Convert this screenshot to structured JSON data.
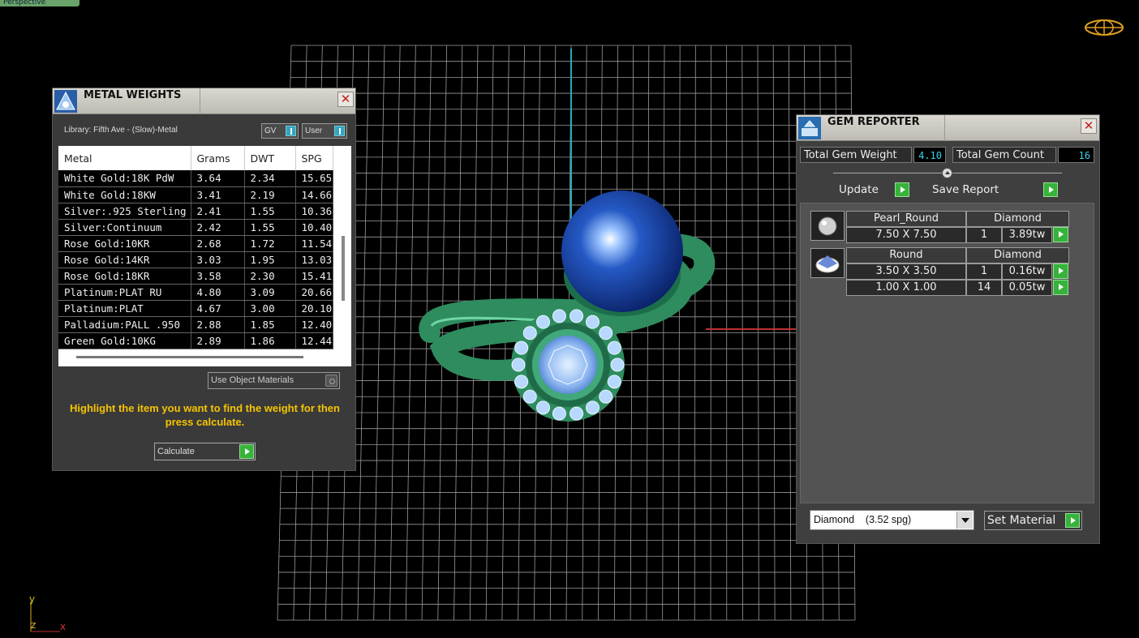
{
  "viewport": {
    "tab_label": "Perspective"
  },
  "metal_weights": {
    "title": "METAL WEIGHTS",
    "library_label": "Library: Fifth Ave - (Slow)-Metal",
    "toggle_gv": "GV",
    "toggle_user": "User",
    "columns": [
      "Metal",
      "Grams",
      "DWT",
      "SPG"
    ],
    "rows": [
      [
        "White Gold:18K PdW",
        "3.64",
        "2.34",
        "15.65"
      ],
      [
        "White Gold:18KW",
        "3.41",
        "2.19",
        "14.66"
      ],
      [
        "Silver:.925 Sterling",
        "2.41",
        "1.55",
        "10.36"
      ],
      [
        "Silver:Continuum",
        "2.42",
        "1.55",
        "10.40"
      ],
      [
        "Rose Gold:10KR",
        "2.68",
        "1.72",
        "11.54"
      ],
      [
        "Rose Gold:14KR",
        "3.03",
        "1.95",
        "13.03"
      ],
      [
        "Rose Gold:18KR",
        "3.58",
        "2.30",
        "15.41"
      ],
      [
        "Platinum:PLAT RU",
        "4.80",
        "3.09",
        "20.66"
      ],
      [
        "Platinum:PLAT",
        "4.67",
        "3.00",
        "20.10"
      ],
      [
        "Palladium:PALL .950",
        "2.88",
        "1.85",
        "12.40"
      ],
      [
        "Green Gold:10KG",
        "2.89",
        "1.86",
        "12.44"
      ]
    ],
    "use_object_materials": "Use Object Materials",
    "hint": "Highlight the item you want to find the weight for then press calculate.",
    "calculate": "Calculate"
  },
  "gem_reporter": {
    "title": "GEM REPORTER",
    "total_weight_label": "Total Gem Weight",
    "total_weight_value": "4.10",
    "total_count_label": "Total Gem Count",
    "total_count_value": "16",
    "update": "Update",
    "save_report": "Save Report",
    "groups": [
      {
        "shape": "Pearl_Round",
        "material": "Diamond",
        "thumb_icon": "pearl-icon",
        "rows": [
          {
            "size": "7.50 X 7.50",
            "count": "1",
            "weight": "3.89tw"
          }
        ]
      },
      {
        "shape": "Round",
        "material": "Diamond",
        "thumb_icon": "round-gem-icon",
        "rows": [
          {
            "size": "3.50 X 3.50",
            "count": "1",
            "weight": "0.16tw"
          },
          {
            "size": "1.00 X 1.00",
            "count": "14",
            "weight": "0.05tw"
          }
        ]
      }
    ],
    "material_select": "Diamond    (3.52 spg)",
    "set_material": "Set Material"
  },
  "axes": {
    "y": "y",
    "z": "z",
    "x": "x"
  },
  "colors": {
    "grid": "#9a9a9a",
    "ring": "#2e8c5e",
    "pearl": "#1d4da8",
    "accent_green": "#36b33a",
    "hint_yellow": "#f5c400",
    "value_cyan": "#3ad0e8"
  }
}
